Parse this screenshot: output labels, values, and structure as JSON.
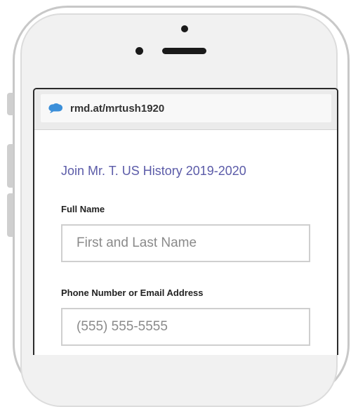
{
  "browser": {
    "url": "rmd.at/mrtush1920",
    "icon": "brain-icon",
    "icon_color": "#3b8fd9"
  },
  "form": {
    "title": "Join Mr. T. US History 2019-2020",
    "title_color": "#5b5ba8",
    "full_name": {
      "label": "Full Name",
      "placeholder": "First and Last Name",
      "value": ""
    },
    "contact": {
      "label": "Phone Number or Email Address",
      "placeholder": "(555) 555-5555",
      "value": ""
    }
  }
}
